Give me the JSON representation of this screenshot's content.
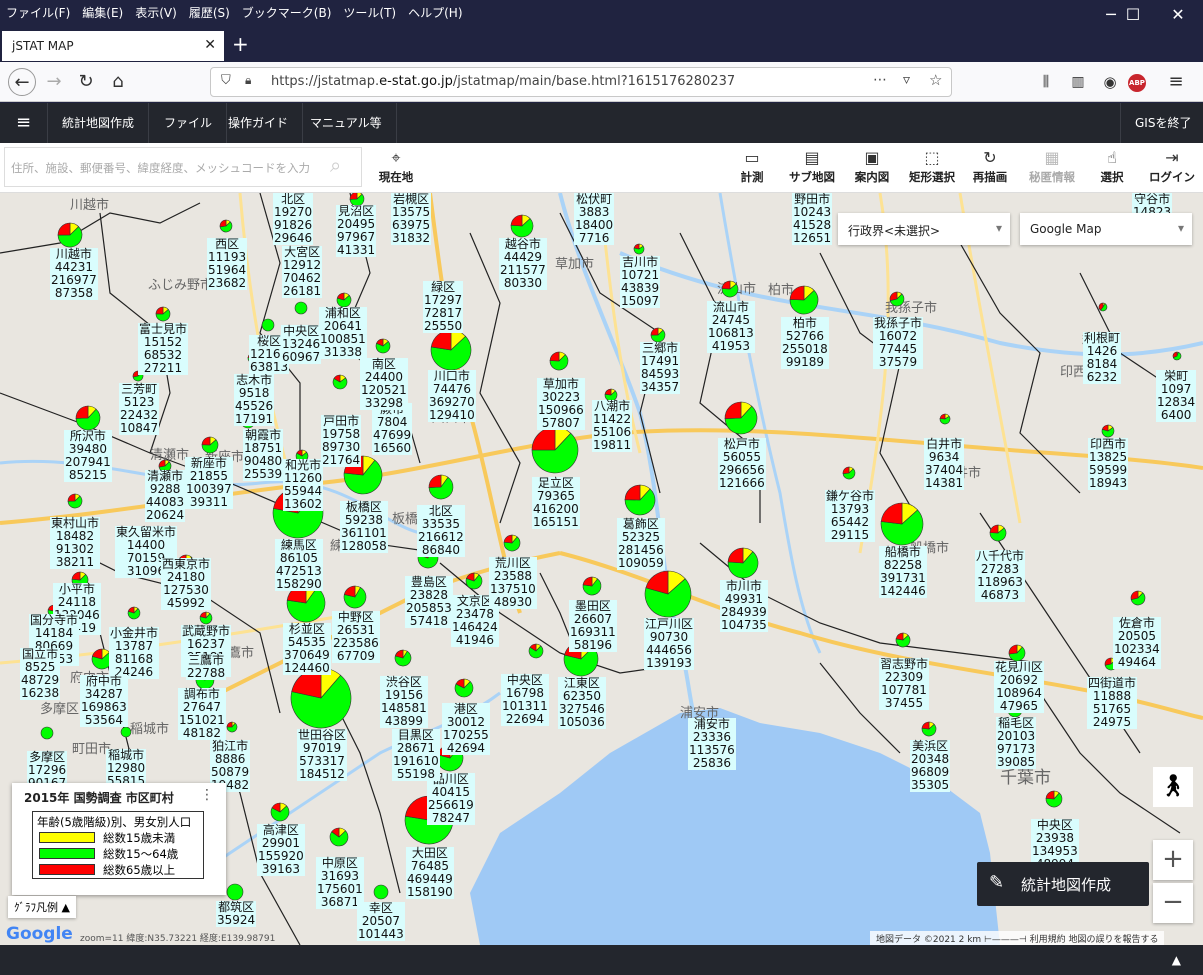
{
  "browser": {
    "menu": [
      "ファイル(F)",
      "編集(E)",
      "表示(V)",
      "履歴(S)",
      "ブックマーク(B)",
      "ツール(T)",
      "ヘルプ(H)"
    ],
    "tab_title": "jSTAT MAP",
    "url_prefix": "https://jstatmap.",
    "url_domain": "e-stat.go.jp",
    "url_suffix": "/jstatmap/main/base.html?1615176280237"
  },
  "app": {
    "menu": [
      "統計地図作成",
      "ファイル",
      "操作ガイド",
      "マニュアル等"
    ],
    "exit_label": "GISを終了"
  },
  "toolbar": {
    "search_placeholder": "住所、施設、郵便番号、緯度経度、メッシュコードを入力",
    "current_location": "現在地",
    "tools": [
      "計測",
      "サブ地図",
      "案内図",
      "矩形選択",
      "再描画",
      "秘匿情報",
      "選択",
      "ログイン"
    ]
  },
  "map": {
    "boundary_select": "行政界<未選択>",
    "basemap_select": "Google Map",
    "legend_title": "2015年 国勢調査 市区町村",
    "legend_header": "年齢(5歳階級)別、男女別人口",
    "legend_items": [
      {
        "label": "総数15歳未満",
        "color": "#ffff00"
      },
      {
        "label": "総数15～64歳",
        "color": "#00ff00"
      },
      {
        "label": "総数65歳以上",
        "color": "#ff0000"
      }
    ],
    "graph_legend_btn": "ｸﾞﾗﾌ凡例 ▲",
    "create_map_btn": "統計地図作成",
    "attribution": "地図データ ©2021   2 km ⊢———⊣   利用規約   地図の誤りを報告する",
    "zoom_info": "zoom=11  緯度:N35.73221 経度:E139.98791",
    "google_logo": "Google",
    "base_labels": [
      "川越市",
      "ふじみ野市",
      "草加市",
      "流山市",
      "柏市",
      "我孫子市",
      "利根町",
      "印西市",
      "白井市",
      "船橋市",
      "千葉市",
      "浦安市",
      "稲城市",
      "多摩区",
      "町田市",
      "新座市",
      "清瀬市",
      "練馬区",
      "板橋区",
      "足立区",
      "川口市",
      "三鷹市",
      "府中市"
    ],
    "regions": [
      {
        "name": "川越市",
        "v": [
          "44231",
          "216977",
          "87358"
        ],
        "r": 12
      },
      {
        "name": "越谷市",
        "v": [
          "44429",
          "211577",
          "80330"
        ],
        "r": 11
      },
      {
        "name": "柏市",
        "v": [
          "52766",
          "255018",
          "99189"
        ],
        "r": 14
      },
      {
        "name": "川口市",
        "v": [
          "74476",
          "369270",
          "129410"
        ],
        "r": 20
      },
      {
        "name": "草加市",
        "v": [
          "30223",
          "150966",
          "57807"
        ],
        "r": 9
      },
      {
        "name": "松戸市",
        "v": [
          "56055",
          "296656",
          "121666"
        ],
        "r": 16
      },
      {
        "name": "足立区",
        "v": [
          "79365",
          "416200",
          "165151"
        ],
        "r": 23
      },
      {
        "name": "所沢市",
        "v": [
          "39480",
          "207941",
          "85215"
        ],
        "r": 12
      },
      {
        "name": "練馬区",
        "v": [
          "86105",
          "472513",
          "158290"
        ],
        "r": 25
      },
      {
        "name": "板橋区",
        "v": [
          "59238",
          "361101",
          "128058"
        ],
        "r": 19
      },
      {
        "name": "北区",
        "v": [
          "33535",
          "216612",
          "86840"
        ],
        "r": 12
      },
      {
        "name": "葛飾区",
        "v": [
          "52325",
          "281456",
          "109059"
        ],
        "r": 15
      },
      {
        "name": "船橋市",
        "v": [
          "82258",
          "391731",
          "142446"
        ],
        "r": 21
      },
      {
        "name": "市川市",
        "v": [
          "49931",
          "284939",
          "104735"
        ],
        "r": 15
      },
      {
        "name": "杉並区",
        "v": [
          "54535",
          "370649",
          "124460"
        ],
        "r": 19
      },
      {
        "name": "江戸川区",
        "v": [
          "90730",
          "444656",
          "139193"
        ],
        "r": 23
      },
      {
        "name": "江東区",
        "v": [
          "62350",
          "327546",
          "105036"
        ],
        "r": 17
      },
      {
        "name": "世田谷区",
        "v": [
          "97019",
          "573317",
          "184512"
        ],
        "r": 30
      },
      {
        "name": "大田区",
        "v": [
          "76485",
          "469449",
          "158190"
        ],
        "r": 24
      },
      {
        "name": "浦安市",
        "v": [
          "23336",
          "113576",
          "25836"
        ],
        "r": 0
      },
      {
        "name": "中野区",
        "v": [
          "26531",
          "223586",
          "67709"
        ],
        "r": 11
      },
      {
        "name": "豊島区",
        "v": [
          "23828",
          "205853",
          "57418"
        ],
        "r": 10
      },
      {
        "name": "文京区",
        "v": [
          "23478",
          "146424",
          "41946"
        ],
        "r": 8
      },
      {
        "name": "墨田区",
        "v": [
          "26607",
          "169311",
          "58196"
        ],
        "r": 9
      },
      {
        "name": "荒川区",
        "v": [
          "23588",
          "137510",
          "48930"
        ],
        "r": 8
      },
      {
        "name": "品川区",
        "v": [
          "40415",
          "256619",
          "78247"
        ],
        "r": 13
      },
      {
        "name": "目黒区",
        "v": [
          "28671",
          "191610",
          "55198"
        ],
        "r": 10
      },
      {
        "name": "渋谷区",
        "v": [
          "19156",
          "148581",
          "43899"
        ],
        "r": 8
      },
      {
        "name": "港区",
        "v": [
          "30012",
          "170255",
          "42694"
        ],
        "r": 9
      },
      {
        "name": "中央区",
        "v": [
          "16798",
          "101311",
          "22694"
        ],
        "r": 7
      },
      {
        "name": "戸田市",
        "v": [
          "19758",
          "89730",
          "21764"
        ],
        "r": 7
      },
      {
        "name": "蕨市",
        "v": [
          "7804",
          "47699",
          "16560"
        ],
        "r": 5
      },
      {
        "name": "朝霞市",
        "v": [
          "18751",
          "90480",
          "25539"
        ],
        "r": 7
      },
      {
        "name": "和光市",
        "v": [
          "11260",
          "55944",
          "13602"
        ],
        "r": 6
      },
      {
        "name": "新座市",
        "v": [
          "21855",
          "100397",
          "39311"
        ],
        "r": 8
      },
      {
        "name": "清瀬市",
        "v": [
          "9288",
          "44083",
          "20624"
        ],
        "r": 6
      },
      {
        "name": "東村山市",
        "v": [
          "18482",
          "91302",
          "38211"
        ],
        "r": 7
      },
      {
        "name": "東久留米市",
        "v": [
          "14400",
          "70159",
          "31096"
        ],
        "r": 7
      },
      {
        "name": "西東京市",
        "v": [
          "24180",
          "127530",
          "45992"
        ],
        "r": 8
      },
      {
        "name": "小平市",
        "v": [
          "24118",
          "122046",
          "44419"
        ],
        "r": 8
      },
      {
        "name": "小金井市",
        "v": [
          "13787",
          "81168",
          "24246"
        ],
        "r": 6
      },
      {
        "name": "武蔵野市",
        "v": [
          "16237",
          "95181",
          "30101"
        ],
        "r": 6
      },
      {
        "name": "三鷹市",
        "v": [
          "22788"
        ],
        "r": 7
      },
      {
        "name": "調布市",
        "v": [
          "27647",
          "151021",
          "48182"
        ],
        "r": 9
      },
      {
        "name": "狛江市",
        "v": [
          "8886",
          "50879",
          "19482"
        ],
        "r": 5
      },
      {
        "name": "府中市",
        "v": [
          "34287",
          "169863",
          "53564"
        ],
        "r": 10
      },
      {
        "name": "国分寺市",
        "v": [
          "14184",
          "80669",
          "26453"
        ],
        "r": 6
      },
      {
        "name": "国立市",
        "v": [
          "8525",
          "48729",
          "16238"
        ],
        "r": 5
      },
      {
        "name": "稲城市",
        "v": [
          "12980",
          "55815"
        ],
        "r": 5
      },
      {
        "name": "多摩区",
        "v": [
          "17296",
          "90167"
        ],
        "r": 6
      },
      {
        "name": "高津区",
        "v": [
          "29901",
          "155920",
          "39163"
        ],
        "r": 9
      },
      {
        "name": "中原区",
        "v": [
          "31693",
          "175601",
          "36871"
        ],
        "r": 9
      },
      {
        "name": "幸区",
        "v": [
          "20507",
          "101443"
        ],
        "r": 7
      },
      {
        "name": "都筑区",
        "v": [
          "35924"
        ],
        "r": 8
      },
      {
        "name": "三郷市",
        "v": [
          "17491",
          "84593",
          "34357"
        ],
        "r": 7
      },
      {
        "name": "八潮市",
        "v": [
          "11422",
          "55106",
          "19811"
        ],
        "r": 6
      },
      {
        "name": "吉川市",
        "v": [
          "10721",
          "43839",
          "15097"
        ],
        "r": 5
      },
      {
        "name": "流山市",
        "v": [
          "24745",
          "106813",
          "41953"
        ],
        "r": 8
      },
      {
        "name": "我孫子市",
        "v": [
          "16072",
          "77445",
          "37579"
        ],
        "r": 7
      },
      {
        "name": "利根町",
        "v": [
          "1426",
          "8184",
          "6232"
        ],
        "r": 4
      },
      {
        "name": "栄町",
        "v": [
          "1097",
          "12834",
          "6400"
        ],
        "r": 4
      },
      {
        "name": "印西市",
        "v": [
          "13825",
          "59599",
          "18943"
        ],
        "r": 6
      },
      {
        "name": "白井市",
        "v": [
          "9634",
          "37404",
          "14381"
        ],
        "r": 5
      },
      {
        "name": "鎌ケ谷市",
        "v": [
          "13793",
          "65442",
          "29115"
        ],
        "r": 6
      },
      {
        "name": "八千代市",
        "v": [
          "27283",
          "118963",
          "46873"
        ],
        "r": 8
      },
      {
        "name": "習志野市",
        "v": [
          "22309",
          "107781",
          "37455"
        ],
        "r": 7
      },
      {
        "name": "花見川区",
        "v": [
          "20692",
          "108964",
          "47965"
        ],
        "r": 8
      },
      {
        "name": "四街道市",
        "v": [
          "11888",
          "51765",
          "24975"
        ],
        "r": 6
      },
      {
        "name": "佐倉市",
        "v": [
          "20505",
          "102334",
          "49464"
        ],
        "r": 7
      },
      {
        "name": "稲毛区",
        "v": [
          "20103",
          "97173",
          "39085"
        ],
        "r": 7
      },
      {
        "name": "美浜区",
        "v": [
          "20348",
          "96809",
          "35305"
        ],
        "r": 7
      },
      {
        "name": "中央区",
        "v": [
          "23938",
          "134953",
          "48994"
        ],
        "r": 8
      },
      {
        "name": "富士見市",
        "v": [
          "15152",
          "68532",
          "27211"
        ],
        "r": 7
      },
      {
        "name": "三芳町",
        "v": [
          "5123",
          "22432",
          "10847"
        ],
        "r": 5
      },
      {
        "name": "志木市",
        "v": [
          "9518",
          "45526",
          "17191"
        ],
        "r": 5
      },
      {
        "name": "浦和区",
        "v": [
          "20641",
          "100851",
          "31338"
        ],
        "r": 7
      },
      {
        "name": "南区",
        "v": [
          "24400",
          "120521",
          "33298"
        ],
        "r": 7
      },
      {
        "name": "大宮区",
        "v": [
          "12912",
          "70462",
          "26181"
        ],
        "r": 6
      },
      {
        "name": "見沼区",
        "v": [
          "20495",
          "97967",
          "41331"
        ],
        "r": 7
      },
      {
        "name": "西区",
        "v": [
          "11193",
          "51964",
          "23682"
        ],
        "r": 6
      },
      {
        "name": "北区",
        "v": [
          "19270",
          "91826",
          "29646"
        ],
        "r": 7
      },
      {
        "name": "岩槻区",
        "v": [
          "13575",
          "63975",
          "31832"
        ],
        "r": 6
      },
      {
        "name": "松伏町",
        "v": [
          "3883",
          "18400",
          "7716"
        ],
        "r": 4
      },
      {
        "name": "緑区",
        "v": [
          "17297",
          "72817",
          "25550"
        ],
        "r": 7
      },
      {
        "name": "桜区",
        "v": [
          "12167",
          "63813"
        ],
        "r": 6
      },
      {
        "name": "中央区",
        "v": [
          "13246",
          "60967"
        ],
        "r": 6
      },
      {
        "name": "野田市",
        "v": [
          "10243",
          "41528",
          "12651"
        ],
        "r": 6
      },
      {
        "name": "守谷市",
        "v": [
          "14823",
          "48395"
        ],
        "r": 6
      }
    ]
  }
}
